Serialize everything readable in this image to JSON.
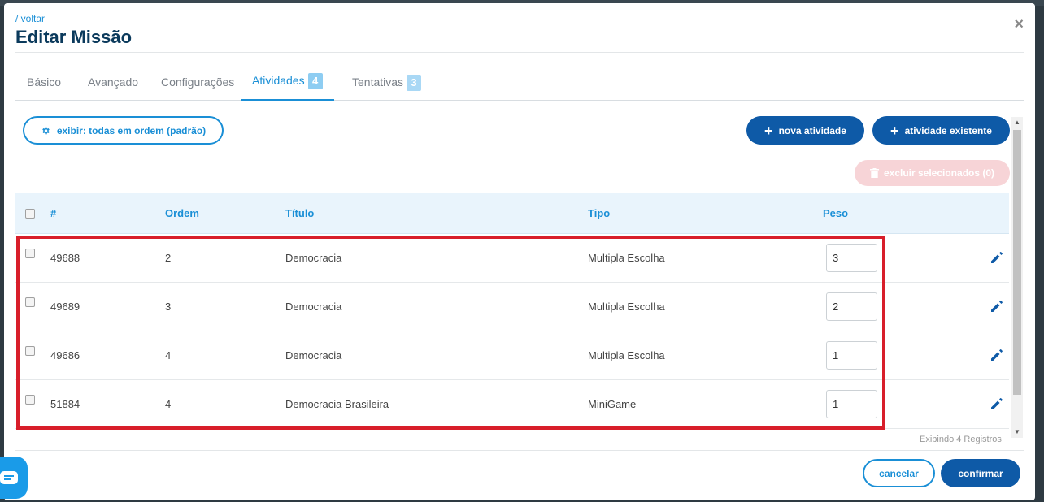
{
  "header": {
    "back_label": "/ voltar",
    "title": "Editar Missão",
    "close_label": "×"
  },
  "tabs": [
    {
      "label": "Básico",
      "badge": ""
    },
    {
      "label": "Avançado",
      "badge": ""
    },
    {
      "label": "Configurações",
      "badge": ""
    },
    {
      "label": "Atividades",
      "badge": "4",
      "active": true
    },
    {
      "label": "Tentativas",
      "badge": "3"
    }
  ],
  "toolbar": {
    "filter_label": "exibir: todas em ordem (padrão)",
    "new_activity_label": "nova atividade",
    "existing_activity_label": "atividade existente",
    "delete_selected_label": "excluir selecionados (0)"
  },
  "table": {
    "headers": [
      "#",
      "Ordem",
      "Título",
      "Tipo",
      "Peso"
    ],
    "rows": [
      {
        "id": "49688",
        "order": "2",
        "title": "Democracia",
        "type": "Multipla Escolha",
        "weight": "3"
      },
      {
        "id": "49689",
        "order": "3",
        "title": "Democracia",
        "type": "Multipla Escolha",
        "weight": "2"
      },
      {
        "id": "49686",
        "order": "4",
        "title": "Democracia",
        "type": "Multipla Escolha",
        "weight": "1"
      },
      {
        "id": "51884",
        "order": "4",
        "title": "Democracia Brasileira",
        "type": "MiniGame",
        "weight": "1"
      }
    ],
    "showing_text": "Exibindo 4 Registros"
  },
  "footer": {
    "cancel_label": "cancelar",
    "confirm_label": "confirmar"
  },
  "colors": {
    "accent": "#1a8fd6",
    "primary_button": "#0e5aa7",
    "highlight": "#d81e2a",
    "table_header_bg": "#e9f4fc"
  },
  "icons": [
    "close-icon",
    "gear-icon",
    "plus-icon",
    "trash-icon",
    "pencil-icon",
    "chat-icon"
  ]
}
